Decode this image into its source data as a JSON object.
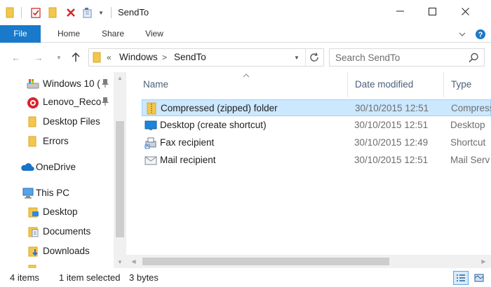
{
  "window": {
    "title": "SendTo"
  },
  "ribbon": {
    "tabs": [
      "File",
      "Home",
      "Share",
      "View"
    ]
  },
  "address": {
    "overflow": "«",
    "segments": [
      "Windows",
      "SendTo"
    ],
    "search_placeholder": "Search SendTo"
  },
  "nav": {
    "items": [
      {
        "label": "Windows 10 (",
        "icon": "drive-icon",
        "pinned": true
      },
      {
        "label": "Lenovo_Reco",
        "icon": "recovery-drive-icon",
        "pinned": true
      },
      {
        "label": "Desktop Files",
        "icon": "folder-icon",
        "pinned": false
      },
      {
        "label": "Errors",
        "icon": "folder-icon",
        "pinned": false
      },
      {
        "label": "OneDrive",
        "icon": "onedrive-icon",
        "pinned": false
      },
      {
        "label": "This PC",
        "icon": "this-pc-icon",
        "pinned": false
      },
      {
        "label": "Desktop",
        "icon": "desktop-folder-icon",
        "pinned": false
      },
      {
        "label": "Documents",
        "icon": "documents-icon",
        "pinned": false
      },
      {
        "label": "Downloads",
        "icon": "downloads-icon",
        "pinned": false
      }
    ]
  },
  "columns": [
    "Name",
    "Date modified",
    "Type"
  ],
  "files": [
    {
      "name": "Compressed (zipped) folder",
      "date": "30/10/2015 12:51",
      "type": "Compress",
      "icon": "zip-folder-icon",
      "selected": true
    },
    {
      "name": "Desktop (create shortcut)",
      "date": "30/10/2015 12:51",
      "type": "Desktop",
      "icon": "desktop-shortcut-icon",
      "selected": false
    },
    {
      "name": "Fax recipient",
      "date": "30/10/2015 12:49",
      "type": "Shortcut",
      "icon": "fax-icon",
      "selected": false
    },
    {
      "name": "Mail recipient",
      "date": "30/10/2015 12:51",
      "type": "Mail Serv",
      "icon": "mail-icon",
      "selected": false
    }
  ],
  "status": {
    "item_count": "4 items",
    "selection": "1 item selected",
    "size": "3 bytes"
  },
  "colors": {
    "accent": "#1979ca",
    "selection_bg": "#cce8ff",
    "selection_border": "#99d1ff",
    "header_text": "#4c607a",
    "folder_yellow": "#f3c74b"
  }
}
